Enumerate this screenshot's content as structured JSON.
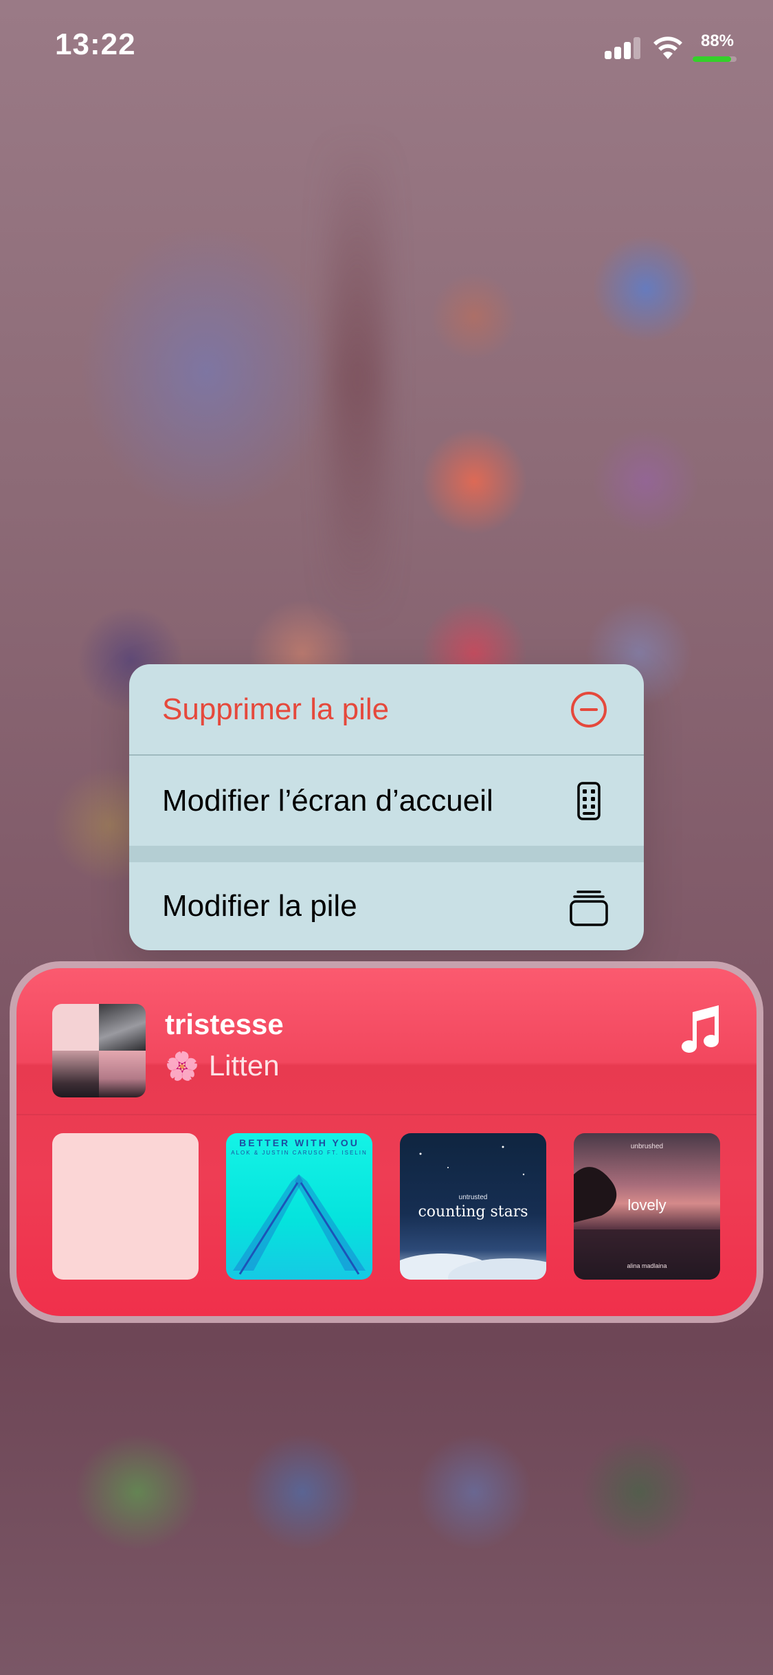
{
  "status_bar": {
    "time": "13:22",
    "battery_percent_label": "88%",
    "battery_level": 0.88,
    "battery_color": "#34d02a",
    "icons": [
      "signal-icon",
      "wifi-icon",
      "battery-icon"
    ]
  },
  "context_menu": {
    "items": [
      {
        "label": "Supprimer la pile",
        "icon": "minus-circle-icon",
        "destructive": true,
        "color": "#e5493c"
      },
      {
        "label": "Modifier l’écran d’accueil",
        "icon": "phone-apps-icon",
        "destructive": false
      },
      {
        "label": "Modifier la pile",
        "icon": "stack-icon",
        "destructive": false
      }
    ]
  },
  "music_widget": {
    "playlist_title": "tristesse",
    "curator_emoji": "🌸",
    "curator": "Litten",
    "app_icon": "music-note-icon",
    "accent_color": "#f0304b",
    "albums": [
      {
        "title": "",
        "lines": []
      },
      {
        "title": "BETTER WITH YOU",
        "lines": [
          "BETTER WITH YOU",
          "ALOK & JUSTIN CARUSO FT. ISELIN"
        ]
      },
      {
        "title": "counting stars",
        "lines": [
          "untrusted",
          "counting stars"
        ]
      },
      {
        "title": "lovely",
        "lines": [
          "unbrushed",
          "lovely",
          "alina madlaina"
        ]
      }
    ]
  }
}
